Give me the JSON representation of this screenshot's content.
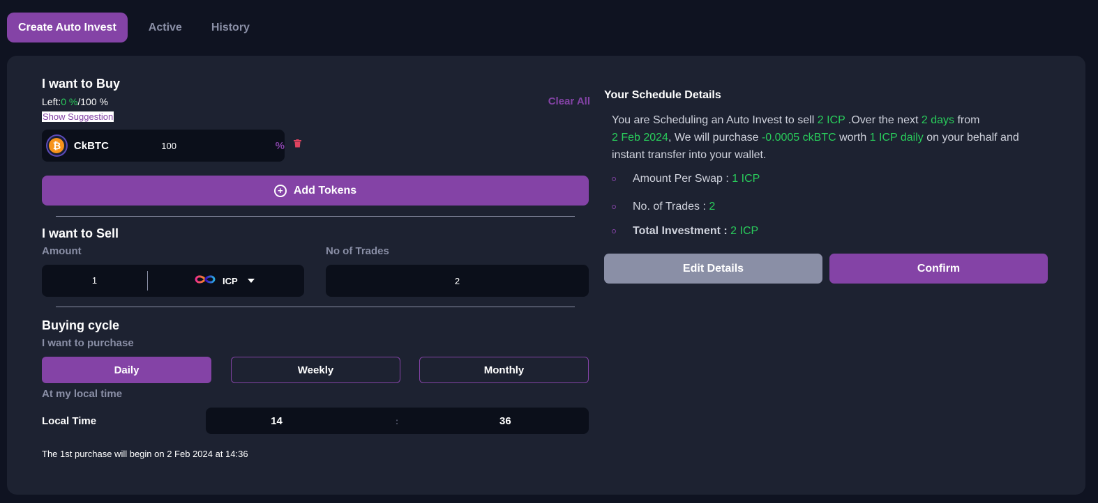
{
  "tabs": [
    {
      "label": "Create Auto Invest"
    },
    {
      "label": "Active"
    },
    {
      "label": "History"
    }
  ],
  "buy": {
    "title": "I want to Buy",
    "left_prefix": "Left:",
    "left_used": "0 %",
    "left_total": "/100 %",
    "show_suggestion": "Show Suggestion",
    "clear_all": "Clear All",
    "token": {
      "name": "CkBTC",
      "value": "100",
      "unit": "%",
      "icon": "bitcoin-icon"
    },
    "add_tokens": "Add Tokens"
  },
  "sell": {
    "title": "I want to Sell",
    "amount_label": "Amount",
    "trades_label": "No of Trades",
    "amount_value": "1",
    "token": "ICP",
    "trades_value": "2"
  },
  "cycle": {
    "title": "Buying cycle",
    "purchase_label": "I want to purchase",
    "options": [
      "Daily",
      "Weekly",
      "Monthly"
    ],
    "selected": "Daily",
    "local_label": "At my local time",
    "local_time_label": "Local Time",
    "hour": "14",
    "separator": ":",
    "minute": "36",
    "first_purchase": "The 1st purchase will begin on 2 Feb 2024 at 14:36"
  },
  "schedule": {
    "title": "Your Schedule Details",
    "p1": "You are Scheduling an Auto Invest to sell ",
    "sell_amount": "2 ICP",
    "p2": " .Over the next ",
    "duration": "2 days",
    "p3": " from",
    "start_date": "2 Feb 2024",
    "p4": ", We will purchase ",
    "buy_amount": "-0.0005 ckBTC",
    "p5": " worth ",
    "frequency": "1 ICP daily",
    "p6": " on your behalf and instant transfer into your wallet.",
    "per_swap_label": "Amount Per Swap : ",
    "per_swap_value": "1 ICP",
    "trades_label": "No. of Trades : ",
    "trades_value": "2",
    "total_label": "Total Investment : ",
    "total_value": "2 ICP"
  },
  "actions": {
    "edit": "Edit Details",
    "confirm": "Confirm"
  },
  "colors": {
    "accent": "#8443a6",
    "green": "#29cc5b",
    "panel": "#1d2231",
    "background": "#0f1321"
  }
}
